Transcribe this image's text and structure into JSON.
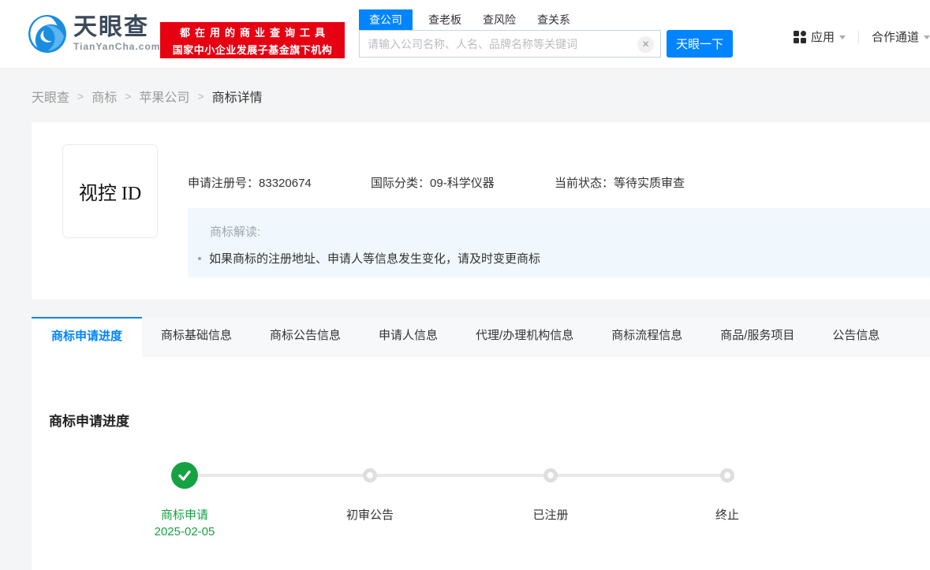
{
  "colors": {
    "brand_blue": "#0084ff",
    "banner_red": "#e60012",
    "success_green": "#16a243",
    "note_bg": "#f0f8fd"
  },
  "icons": {
    "clear": "✕",
    "check": "✓",
    "breadcrumb_separator": ">",
    "apps_grid": "grid-icon",
    "caret_down": "chevron-down"
  },
  "header": {
    "logo": {
      "title": "天眼查",
      "domain": "TianYanCha.com"
    },
    "banner": {
      "line1": "都在用的商业查询工具",
      "line2": "国家中小企业发展子基金旗下机构"
    },
    "search": {
      "tabs": [
        {
          "label": "查公司",
          "active": true
        },
        {
          "label": "查老板",
          "active": false
        },
        {
          "label": "查风险",
          "active": false
        },
        {
          "label": "查关系",
          "active": false
        }
      ],
      "placeholder": "请输入公司名称、人名、品牌名称等关键词",
      "button": "天眼一下"
    },
    "nav": {
      "apps": "应用",
      "partner": "合作通道"
    }
  },
  "breadcrumb": {
    "items": [
      "天眼查",
      "商标",
      "苹果公司",
      "商标详情"
    ]
  },
  "trademark": {
    "image_text": "视控 ID",
    "reg_label": "申请注册号：",
    "reg_no": "83320674",
    "class_label": "国际分类：",
    "class_value": "09-科学仪器",
    "status_label": "当前状态：",
    "status_value": "等待实质审查",
    "note_title": "商标解读:",
    "note_item": "如果商标的注册地址、申请人等信息发生变化，请及时变更商标"
  },
  "tabs": [
    {
      "label": "商标申请进度",
      "active": true
    },
    {
      "label": "商标基础信息",
      "active": false
    },
    {
      "label": "商标公告信息",
      "active": false
    },
    {
      "label": "申请人信息",
      "active": false
    },
    {
      "label": "代理/办理机构信息",
      "active": false
    },
    {
      "label": "商标流程信息",
      "active": false
    },
    {
      "label": "商品/服务项目",
      "active": false
    },
    {
      "label": "公告信息",
      "active": false
    }
  ],
  "progress": {
    "title": "商标申请进度",
    "steps": [
      {
        "label": "商标申请",
        "date": "2025-02-05",
        "done": true
      },
      {
        "label": "初审公告",
        "done": false
      },
      {
        "label": "已注册",
        "done": false
      },
      {
        "label": "终止",
        "done": false
      }
    ]
  }
}
